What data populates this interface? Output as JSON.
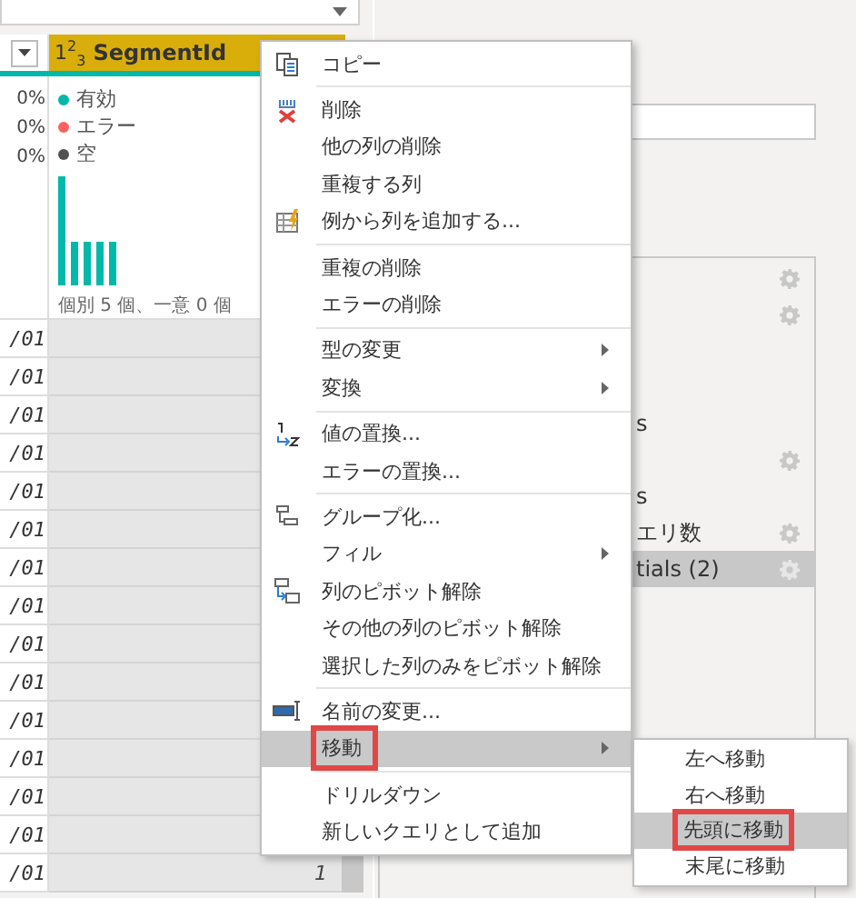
{
  "grid": {
    "left_column": {
      "profile": [
        "0%",
        "0%",
        "0%"
      ]
    },
    "segment_column": {
      "type_icon": "1$^{2}$$_{3}$",
      "title": "SegmentId",
      "legend": [
        {
          "label": "有効",
          "color": "#01b8aa"
        },
        {
          "label": "エラー",
          "color": "#fd625e"
        },
        {
          "label": "空",
          "color": "#505050"
        }
      ],
      "summary": "個別 5 個、一意 0 個"
    },
    "rows": [
      {
        "date": "/01"
      },
      {
        "date": "/01"
      },
      {
        "date": "/01"
      },
      {
        "date": "/01"
      },
      {
        "date": "/01"
      },
      {
        "date": "/01"
      },
      {
        "date": "/01"
      },
      {
        "date": "/01"
      },
      {
        "date": "/01"
      },
      {
        "date": "/01"
      },
      {
        "date": "/01"
      },
      {
        "date": "/01"
      },
      {
        "date": "/01"
      },
      {
        "date": "/01"
      },
      {
        "date": "/01",
        "value": "1"
      }
    ]
  },
  "queries": [
    {
      "gear": true,
      "selected": false
    },
    {
      "gear": true,
      "selected": false
    },
    {
      "gear": false,
      "selected": false
    },
    {
      "gear": false,
      "selected": false
    },
    {
      "label": "s",
      "gear": false,
      "selected": false
    },
    {
      "gear": true,
      "selected": false
    },
    {
      "label": "s",
      "gear": false,
      "selected": false
    },
    {
      "label": "エリ数",
      "gear": true,
      "selected": false
    },
    {
      "label": "tials (2)",
      "gear": true,
      "selected": true
    }
  ],
  "menu": {
    "items": [
      {
        "kind": "item",
        "label": "コピー",
        "submenu": false,
        "selected": false,
        "outlined": false
      },
      {
        "kind": "divider"
      },
      {
        "kind": "item",
        "label": "削除",
        "submenu": false,
        "selected": false,
        "outlined": false
      },
      {
        "kind": "item",
        "label": "他の列の削除",
        "submenu": false,
        "selected": false,
        "outlined": false
      },
      {
        "kind": "item",
        "label": "重複する列",
        "submenu": false,
        "selected": false,
        "outlined": false
      },
      {
        "kind": "item",
        "label": "例から列を追加する...",
        "submenu": false,
        "selected": false,
        "outlined": false
      },
      {
        "kind": "divider"
      },
      {
        "kind": "item",
        "label": "重複の削除",
        "submenu": false,
        "selected": false,
        "outlined": false
      },
      {
        "kind": "item",
        "label": "エラーの削除",
        "submenu": false,
        "selected": false,
        "outlined": false
      },
      {
        "kind": "divider"
      },
      {
        "kind": "item",
        "label": "型の変更",
        "submenu": true,
        "selected": false,
        "outlined": false
      },
      {
        "kind": "item",
        "label": "変換",
        "submenu": true,
        "selected": false,
        "outlined": false
      },
      {
        "kind": "divider"
      },
      {
        "kind": "item",
        "label": "値の置換...",
        "submenu": false,
        "selected": false,
        "outlined": false
      },
      {
        "kind": "item",
        "label": "エラーの置換...",
        "submenu": false,
        "selected": false,
        "outlined": false
      },
      {
        "kind": "divider"
      },
      {
        "kind": "item",
        "label": "グループ化...",
        "submenu": false,
        "selected": false,
        "outlined": false
      },
      {
        "kind": "item",
        "label": "フィル",
        "submenu": true,
        "selected": false,
        "outlined": false
      },
      {
        "kind": "item",
        "label": "列のピボット解除",
        "submenu": false,
        "selected": false,
        "outlined": false
      },
      {
        "kind": "item",
        "label": "その他の列のピボット解除",
        "submenu": false,
        "selected": false,
        "outlined": false
      },
      {
        "kind": "item",
        "label": "選択した列のみをピボット解除",
        "submenu": false,
        "selected": false,
        "outlined": false
      },
      {
        "kind": "divider"
      },
      {
        "kind": "item",
        "label": "名前の変更...",
        "submenu": false,
        "selected": false,
        "outlined": false
      },
      {
        "kind": "item",
        "label": "移動",
        "submenu": true,
        "selected": true,
        "outlined": true
      },
      {
        "kind": "divider"
      },
      {
        "kind": "item",
        "label": "ドリルダウン",
        "submenu": false,
        "selected": false,
        "outlined": false
      },
      {
        "kind": "item",
        "label": "新しいクエリとして追加",
        "submenu": false,
        "selected": false,
        "outlined": false
      }
    ]
  },
  "submenu": {
    "items": [
      {
        "label": "左へ移動",
        "selected": false,
        "outlined": false
      },
      {
        "label": "右へ移動",
        "selected": false,
        "outlined": false
      },
      {
        "label": "先頭に移動",
        "selected": true,
        "outlined": true
      },
      {
        "label": "末尾に移動",
        "selected": false,
        "outlined": false
      }
    ]
  }
}
